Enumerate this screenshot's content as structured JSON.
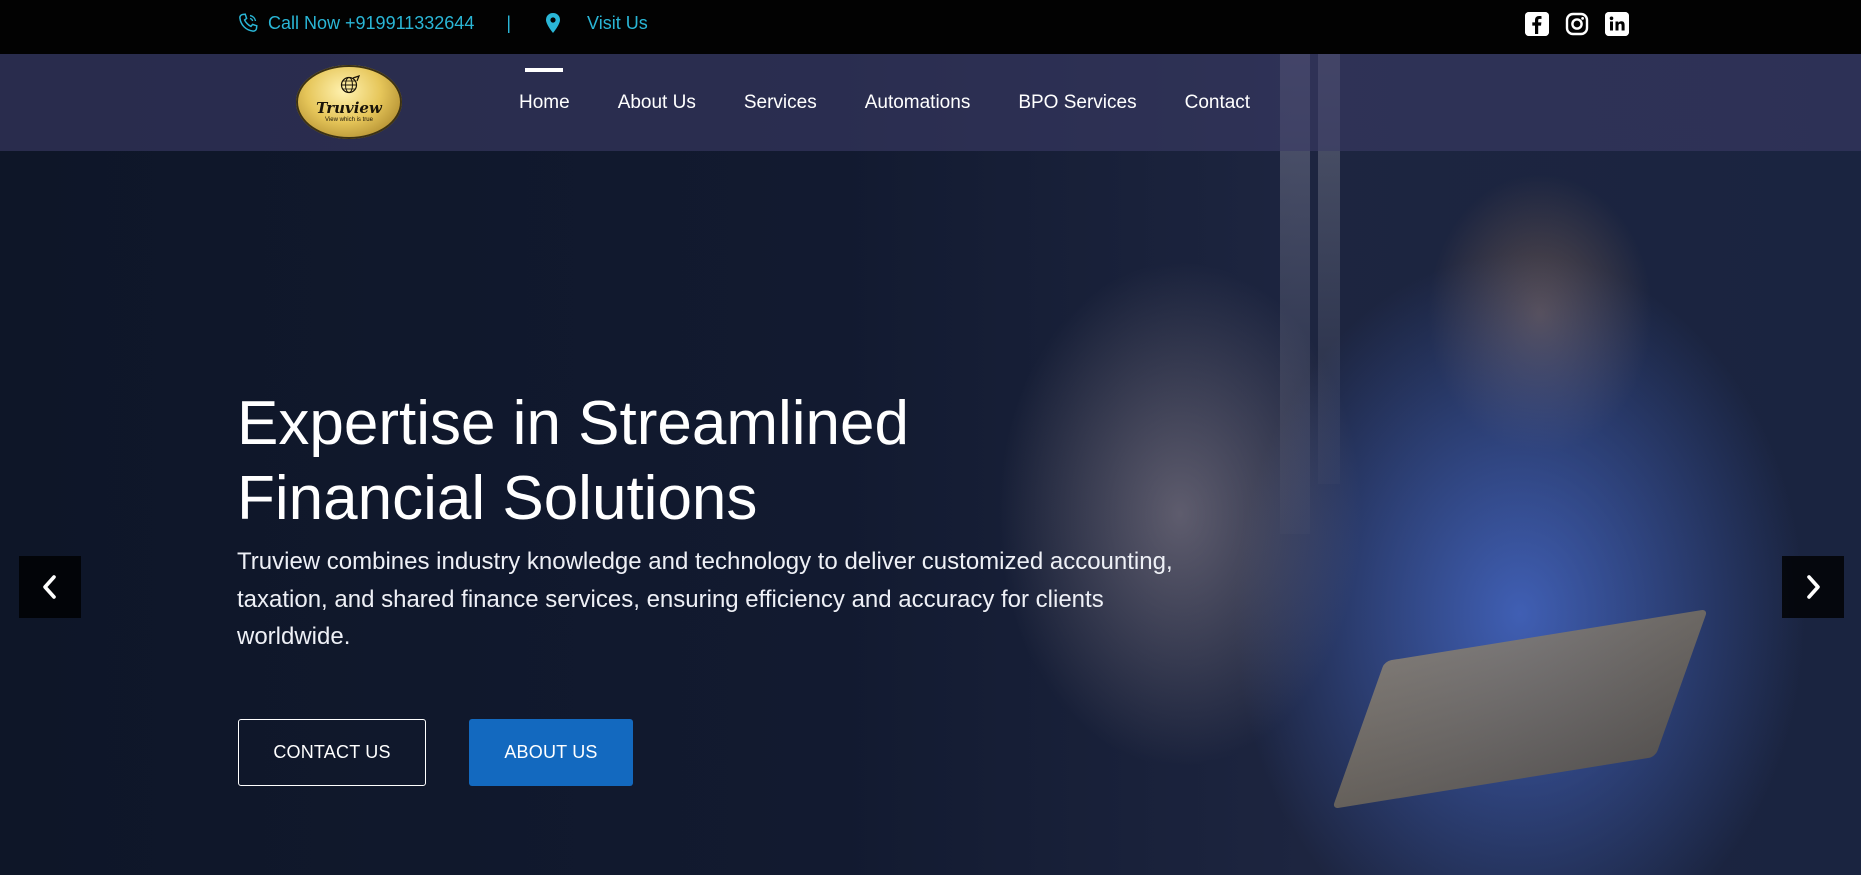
{
  "topbar": {
    "call_label": "Call Now +919911332644",
    "separator": "|",
    "visit_label": "Visit Us",
    "text_color": "#2ab6d6",
    "social": [
      "facebook-icon",
      "instagram-icon",
      "linkedin-icon"
    ]
  },
  "logo": {
    "name": "Truview",
    "tagline": "View which is true"
  },
  "nav": {
    "items": [
      {
        "label": "Home",
        "active": true
      },
      {
        "label": "About Us"
      },
      {
        "label": "Services"
      },
      {
        "label": "Automations"
      },
      {
        "label": "BPO Services"
      },
      {
        "label": "Contact"
      }
    ]
  },
  "hero": {
    "title_line1": "Expertise in Streamlined",
    "title_line2": "Financial Solutions",
    "description": "Truview combines industry knowledge and technology to deliver customized accounting, taxation, and shared finance services, ensuring efficiency and accuracy for clients worldwide.",
    "contact_button": "CONTACT US",
    "about_button": "ABOUT US",
    "accent_color": "#1369bf"
  },
  "carousel": {
    "prev_icon": "chevron-left-icon",
    "next_icon": "chevron-right-icon"
  }
}
